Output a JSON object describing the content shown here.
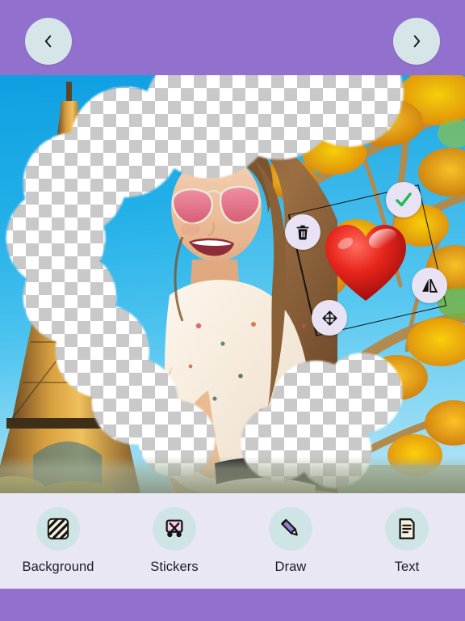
{
  "app": {
    "accent_purple": "#9270cd",
    "toolbar_bg": "#eae7f4",
    "nav_button_bg": "#d6e6e8",
    "tool_icon_bg": "#cfe4e4",
    "handle_bg": "#e9e2f4",
    "confirm_green": "#22c55e"
  },
  "header": {
    "prev_label": "Previous",
    "prev_icon": "chevron-left-icon",
    "next_label": "Next",
    "next_icon": "chevron-right-icon"
  },
  "canvas": {
    "description": "Photo editor canvas: woman with pink heart sunglasses composited over Eiffel Tower and autumn foliage background with erased transparent areas",
    "background_subject": "eiffel-tower",
    "background_right": "autumn-foliage",
    "transparency_pattern": "checkerboard"
  },
  "sticker": {
    "name": "red-heart-sticker",
    "selected": true,
    "handles": [
      {
        "id": "delete",
        "icon": "trash-icon",
        "label": "Delete sticker"
      },
      {
        "id": "confirm",
        "icon": "check-icon",
        "label": "Confirm sticker"
      },
      {
        "id": "flip",
        "icon": "flip-horizontal-icon",
        "label": "Flip sticker"
      },
      {
        "id": "move",
        "icon": "move-arrows-icon",
        "label": "Move sticker"
      }
    ]
  },
  "toolbar": {
    "items": [
      {
        "label": "Background",
        "icon": "stripes-square-icon"
      },
      {
        "label": "Stickers",
        "icon": "scissors-icon"
      },
      {
        "label": "Draw",
        "icon": "pencil-icon"
      },
      {
        "label": "Text",
        "icon": "document-lines-icon"
      }
    ]
  }
}
